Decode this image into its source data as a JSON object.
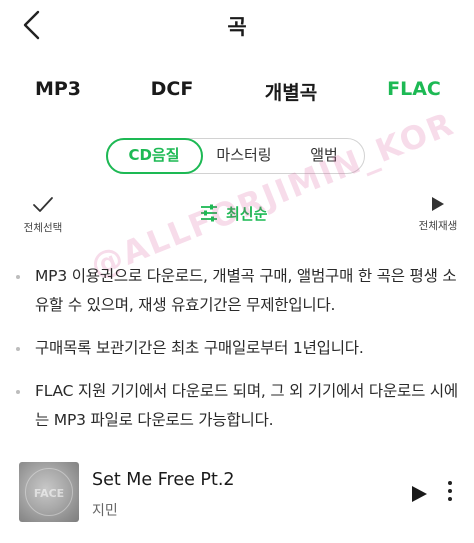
{
  "header": {
    "title": "곡",
    "back_icon": "chevron-left-icon"
  },
  "format_tabs": [
    {
      "label": "MP3",
      "active": false
    },
    {
      "label": "DCF",
      "active": false
    },
    {
      "label": "개별곡",
      "active": false
    },
    {
      "label": "FLAC",
      "active": true
    }
  ],
  "quality_segment": {
    "options": [
      "CD음질",
      "마스터링",
      "앨범"
    ],
    "selected": "CD음질"
  },
  "toolbar": {
    "select_all_label": "전체선택",
    "select_all_icon": "checkmark-icon",
    "sort_label": "최신순",
    "sort_icon": "sliders-icon",
    "play_all_label": "전체재생",
    "play_all_icon": "play-icon"
  },
  "notices": [
    "MP3 이용권으로 다운로드, 개별곡 구매, 앨범구매 한 곡은 평생 소유할 수 있으며, 재생 유효기간은 무제한입니다.",
    "구매목록 보관기간은 최초 구매일로부터 1년입니다.",
    "FLAC 지원 기기에서 다운로드 되며, 그 외 기기에서 다운로드 시에는 MP3 파일로 다운로드 가능합니다."
  ],
  "watermark": "@ALLFORJIMIN_KOR",
  "song": {
    "title": "Set Me Free Pt.2",
    "artist": "지민",
    "cover_text": "FACE"
  },
  "colors": {
    "accent": "#1db954",
    "text": "#1a1a1a",
    "muted": "#666666"
  }
}
